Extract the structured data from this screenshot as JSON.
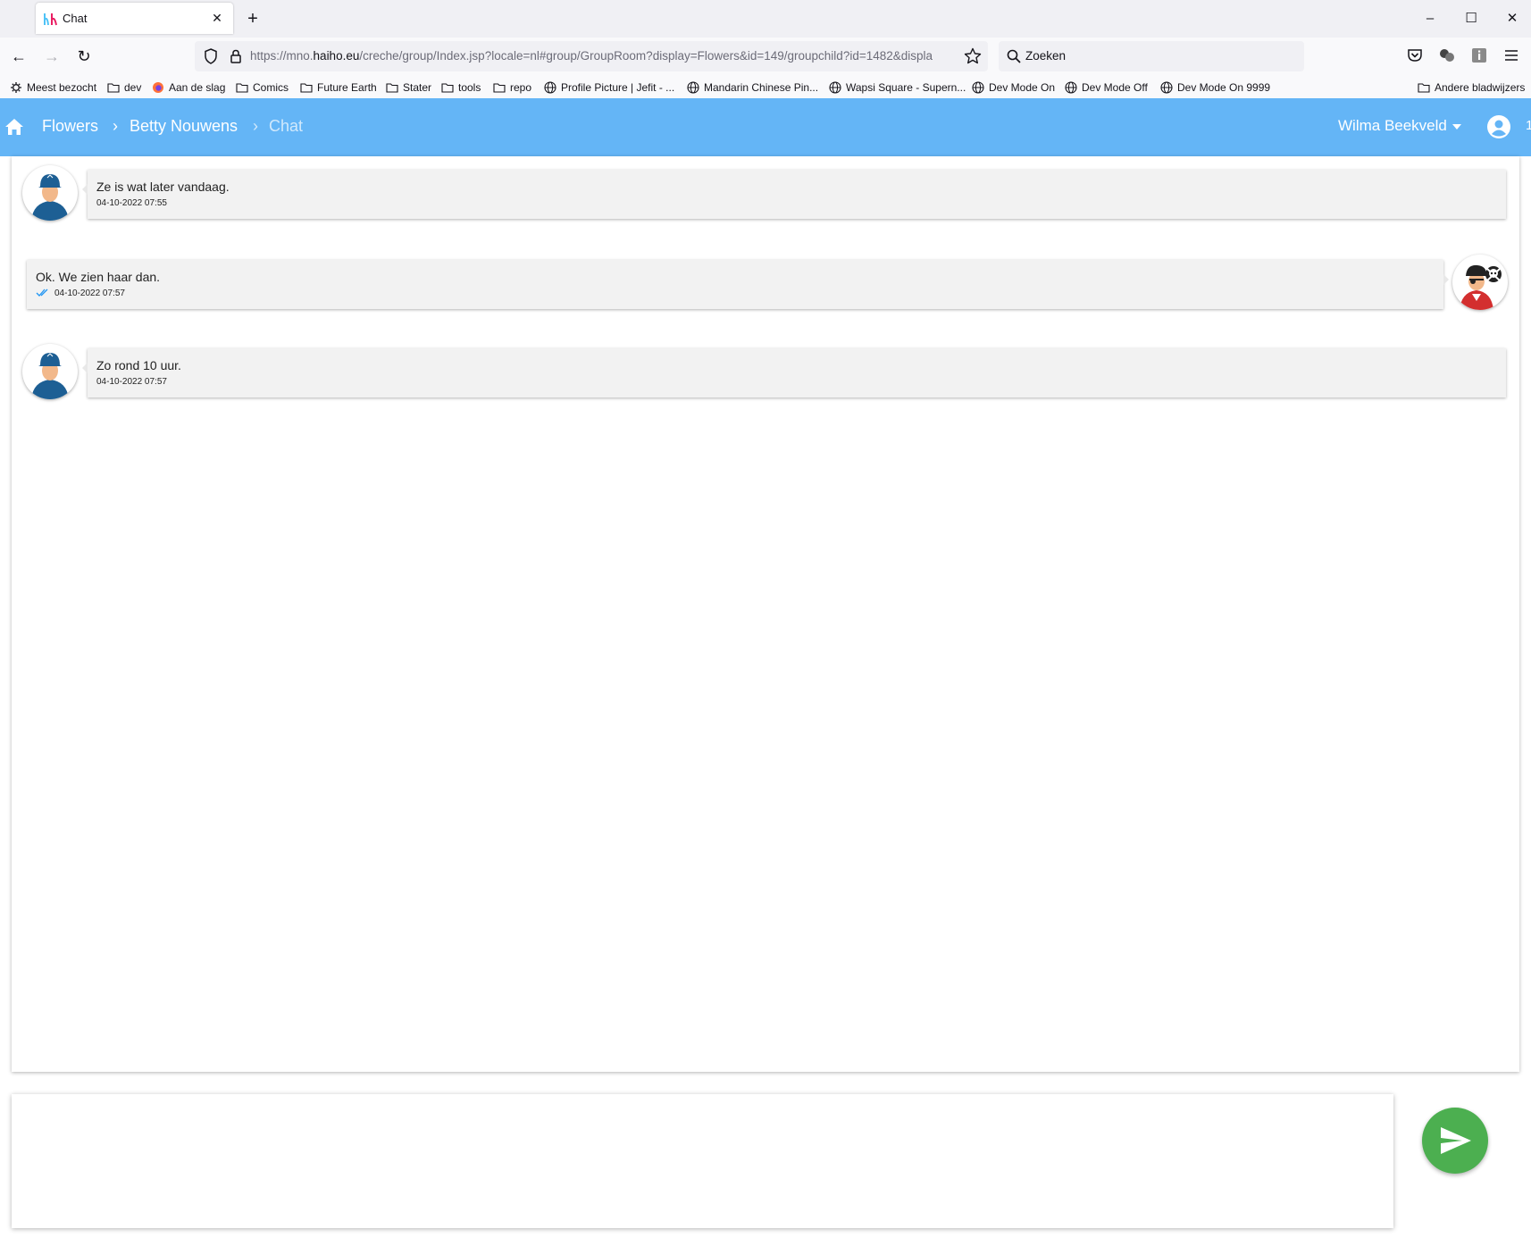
{
  "browser": {
    "tab": {
      "title": "Chat"
    },
    "url": {
      "prefix": "https://mno.",
      "domain": "haiho.eu",
      "path": "/creche/group/Index.jsp?locale=nl#group/GroupRoom?display=Flowers&id=149/groupchild?id=1482&displa"
    },
    "search": {
      "placeholder": "Zoeken"
    },
    "bookmarks": {
      "items": [
        {
          "label": "Meest bezocht",
          "icon": "gear-icon"
        },
        {
          "label": "dev",
          "icon": "folder-icon"
        },
        {
          "label": "Aan de slag",
          "icon": "firefox-icon"
        },
        {
          "label": "Comics",
          "icon": "folder-icon"
        },
        {
          "label": "Future Earth",
          "icon": "folder-icon"
        },
        {
          "label": "Stater",
          "icon": "folder-icon"
        },
        {
          "label": "tools",
          "icon": "folder-icon"
        },
        {
          "label": "repo",
          "icon": "folder-icon"
        },
        {
          "label": "Profile Picture | Jefit - ...",
          "icon": "globe-icon"
        },
        {
          "label": "Mandarin Chinese Pin...",
          "icon": "globe-icon"
        },
        {
          "label": "Wapsi Square - Supern...",
          "icon": "globe-icon"
        },
        {
          "label": "Dev Mode On",
          "icon": "globe-icon"
        },
        {
          "label": "Dev Mode Off",
          "icon": "globe-icon"
        },
        {
          "label": "Dev Mode On 9999",
          "icon": "globe-icon"
        }
      ],
      "other": "Andere bladwijzers"
    }
  },
  "header": {
    "breadcrumb": [
      "Flowers",
      "Betty Nouwens",
      "Chat"
    ],
    "user": "Wilma Beekveld",
    "badge": "1"
  },
  "messages": [
    {
      "text": "Ze is wat later vandaag.",
      "time": "04-10-2022 07:55",
      "side": "left",
      "avatar": "caregiver-avatar"
    },
    {
      "text": "Ok. We zien haar dan.",
      "time": "04-10-2022 07:57",
      "side": "right",
      "avatar": "pirate-avatar",
      "read": true
    },
    {
      "text": "Zo rond 10 uur.",
      "time": "04-10-2022 07:57",
      "side": "left",
      "avatar": "caregiver-avatar"
    }
  ],
  "composer": {
    "value": ""
  },
  "colors": {
    "header": "#64b5f6",
    "send": "#4caf50",
    "bubble": "#f2f2f2"
  }
}
